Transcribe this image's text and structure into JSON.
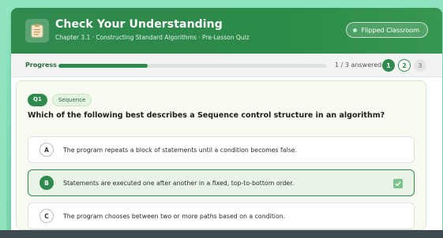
{
  "header": {
    "title": "Check Your Understanding",
    "subtitle": "Chapter 3.1 · Constructing Standard Algorithms · Pre-Lesson Quiz",
    "pill_label": "Flipped Classroom",
    "icon": "clipboard-icon"
  },
  "progress": {
    "label": "Progress",
    "fraction": 0.333,
    "answered_text": "1 / 3 answered",
    "steps": [
      "1",
      "2",
      "3"
    ]
  },
  "question": {
    "number": "Q1",
    "topic": "Sequence",
    "text_before": "Which of the following best describes a ",
    "text_bold": "Sequence",
    "text_after": " control structure in an algorithm?"
  },
  "options": [
    {
      "letter": "A",
      "text": "The program repeats a block of statements until a condition becomes false.",
      "selected": false
    },
    {
      "letter": "B",
      "text": "Statements are executed one after another in a fixed, top-to-bottom order.",
      "selected": true
    },
    {
      "letter": "C",
      "text": "The program chooses between two or more paths based on a condition.",
      "selected": false
    }
  ],
  "colors": {
    "accent": "#2f8a4e",
    "background": "#8ee6c1"
  }
}
